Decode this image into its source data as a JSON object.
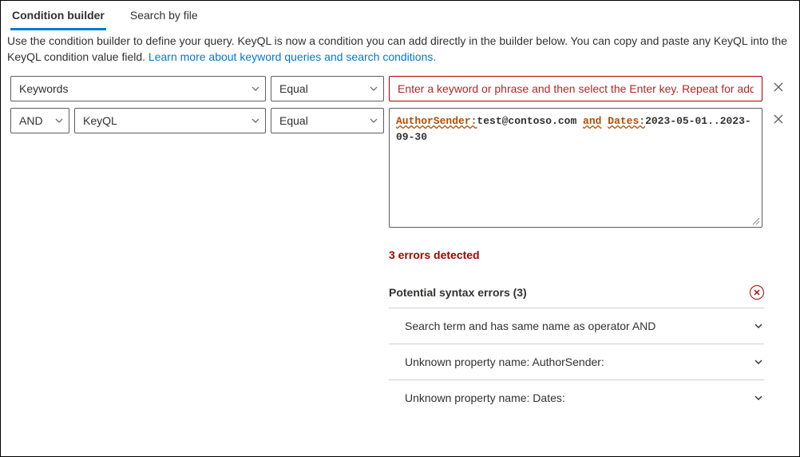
{
  "tabs": {
    "builder": "Condition builder",
    "file": "Search by file"
  },
  "description": {
    "text_before": "Use the condition builder to define your query. KeyQL is now a condition you can add directly in the builder below. You can copy and paste any KeyQL into the KeyQL condition value field. ",
    "link": "Learn more about keyword queries and search conditions."
  },
  "rows": [
    {
      "field": "Keywords",
      "operator": "Equal",
      "value_placeholder": "Enter a keyword or phrase and then select the Enter key. Repeat for additional..."
    },
    {
      "logic": "AND",
      "field": "KeyQL",
      "operator": "Equal",
      "keyql_parts": {
        "p1": "AuthorSender:",
        "p2": "test@contoso.com ",
        "p3": "and",
        "p4": " ",
        "p5": "Dates:",
        "p6": "2023-05-01..2023-09-30"
      }
    }
  ],
  "errors": {
    "summary": "3 errors detected",
    "group_title": "Potential syntax errors (3)",
    "items": [
      "Search term and has same name as operator AND",
      "Unknown property name: AuthorSender:",
      "Unknown property name: Dates:"
    ]
  }
}
